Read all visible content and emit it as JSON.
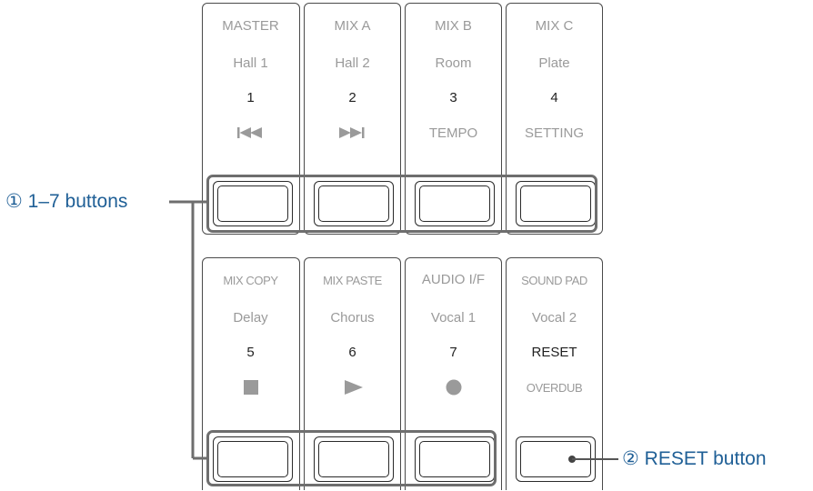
{
  "columns_top": [
    {
      "mode": "MASTER",
      "effect": "Hall 1",
      "number": "1",
      "icon": "previous-icon"
    },
    {
      "mode": "MIX A",
      "effect": "Hall 2",
      "number": "2",
      "icon": "next-icon"
    },
    {
      "mode": "MIX B",
      "effect": "Room",
      "number": "3",
      "function": "TEMPO"
    },
    {
      "mode": "MIX C",
      "effect": "Plate",
      "number": "4",
      "function": "SETTING"
    }
  ],
  "columns_bottom": [
    {
      "mode": "MIX COPY",
      "effect": "Delay",
      "number": "5",
      "icon": "stop-icon"
    },
    {
      "mode": "MIX PASTE",
      "effect": "Chorus",
      "number": "6",
      "icon": "play-icon"
    },
    {
      "mode": "AUDIO I/F",
      "effect": "Vocal 1",
      "number": "7",
      "icon": "record-icon"
    },
    {
      "mode": "SOUND PAD",
      "effect": "Vocal 2",
      "number": "RESET",
      "function": "OVERDUB"
    }
  ],
  "callouts": {
    "buttons_1_7": "① 1–7 buttons",
    "reset_button": "② RESET button"
  },
  "colors": {
    "callout": "#1f5f96",
    "label_gray": "#9a9a9a",
    "outline": "#2a2a2a"
  }
}
